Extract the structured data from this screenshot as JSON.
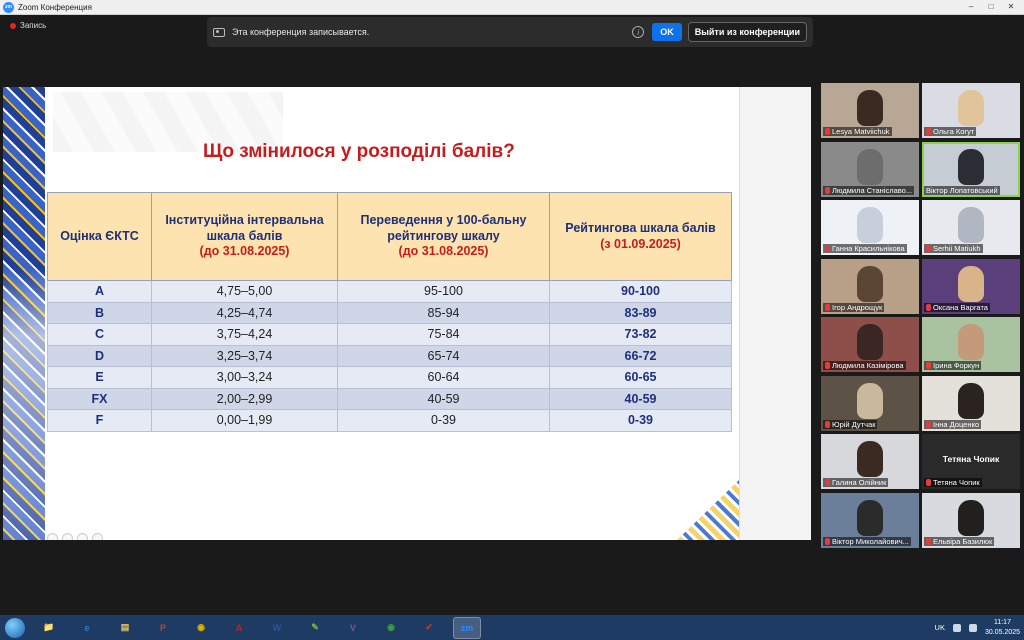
{
  "window": {
    "title": "Zoom Конференция",
    "controls": [
      "–",
      "□",
      "✕"
    ]
  },
  "recording": {
    "label": "Запись",
    "notice": "Эта конференция записывается.",
    "ok_label": "OK",
    "leave_label": "Выйти из конференции"
  },
  "slide": {
    "title": "Що змінилося у розподілі балів?",
    "headers": [
      {
        "main": "Оцінка ЄКТС",
        "note": ""
      },
      {
        "main": "Інституційна інтервальна шкала балів",
        "note": "(до 31.08.2025)"
      },
      {
        "main": "Переведення у 100-бальну рейтингову шкалу",
        "note": "(до 31.08.2025)"
      },
      {
        "main": "Рейтингова шкала балів",
        "note": "(з 01.09.2025)"
      }
    ],
    "rows": [
      [
        "A",
        "4,75–5,00",
        "95-100",
        "90-100"
      ],
      [
        "B",
        "4,25–4,74",
        "85-94",
        "83-89"
      ],
      [
        "C",
        "3,75–4,24",
        "75-84",
        "73-82"
      ],
      [
        "D",
        "3,25–3,74",
        "65-74",
        "66-72"
      ],
      [
        "E",
        "3,00–3,24",
        "60-64",
        "60-65"
      ],
      [
        "FX",
        "2,00–2,99",
        "40-59",
        "40-59"
      ],
      [
        "F",
        "0,00–1,99",
        "0-39",
        "0-39"
      ]
    ]
  },
  "participants": [
    {
      "name": "Lesya Matviichuk",
      "muted": true,
      "bg": "#b9a796",
      "face": "#3b2a22"
    },
    {
      "name": "Ольга Когут",
      "muted": true,
      "bg": "#d9dde3",
      "face": "#e1c49a"
    },
    {
      "name": "Людмила Станіславо...",
      "muted": true,
      "bg": "#8a8a8a",
      "face": "#6d6d6d"
    },
    {
      "name": "Віктор Лопатовський",
      "muted": false,
      "bg": "#c6ccd4",
      "face": "#2c2c34",
      "active": true
    },
    {
      "name": "Ганна Красильнікова",
      "muted": true,
      "bg": "#eef2f7",
      "face": "#c7cfdb"
    },
    {
      "name": "Serhii Matiukh",
      "muted": true,
      "bg": "#e7e9ee",
      "face": "#b0b7c3"
    },
    {
      "name": "Ігор Андрощук",
      "muted": true,
      "bg": "#b8a088",
      "face": "#5b4636"
    },
    {
      "name": "Оксана Варгата",
      "muted": true,
      "bg": "#5a3f7a",
      "face": "#d9b489"
    },
    {
      "name": "Людмила Казімірова",
      "muted": true,
      "bg": "#8e4f4b",
      "face": "#3a2622"
    },
    {
      "name": "Ірина Форкун",
      "muted": true,
      "bg": "#a9c3a0",
      "face": "#c49a7a"
    },
    {
      "name": "Юрій Дутчак",
      "muted": true,
      "bg": "#5c5346",
      "face": "#c9b89b"
    },
    {
      "name": "Інна Доценко",
      "muted": true,
      "bg": "#e4e0da",
      "face": "#2a2320"
    },
    {
      "name": "Галина Олійник",
      "muted": true,
      "bg": "#d6d8db",
      "face": "#3b2a22"
    },
    {
      "name": "Тетяна Чопик",
      "muted": true,
      "bg": "#2a2a2a",
      "face": "",
      "big": "Тетяна Чопик"
    },
    {
      "name": "Віктор Миколайович...",
      "muted": true,
      "bg": "#6b7f9a",
      "face": "#2b2b2b"
    },
    {
      "name": "Ельвіра Базилюк",
      "muted": true,
      "bg": "#d7dadf",
      "face": "#22201f"
    }
  ],
  "taskbar": {
    "apps": [
      {
        "name": "explorer-app",
        "label": "📁",
        "color": "#d7a634"
      },
      {
        "name": "ie-app",
        "label": "e",
        "color": "#2a7bd6"
      },
      {
        "name": "folder-app",
        "label": "▤",
        "color": "#e6c35a"
      },
      {
        "name": "powerpoint-app",
        "label": "P",
        "color": "#c2462b"
      },
      {
        "name": "chrome-app",
        "label": "◉",
        "color": "#e6b500"
      },
      {
        "name": "acrobat-app",
        "label": "A",
        "color": "#c71f1f"
      },
      {
        "name": "word-app",
        "label": "W",
        "color": "#2b579a"
      },
      {
        "name": "paint-app",
        "label": "✎",
        "color": "#7fb13a"
      },
      {
        "name": "viber-app",
        "label": "V",
        "color": "#7b519d"
      },
      {
        "name": "chrome2-app",
        "label": "◉",
        "color": "#3a9e45"
      },
      {
        "name": "tool-app",
        "label": "✔",
        "color": "#c0392b"
      },
      {
        "name": "zoom-app",
        "label": "zm",
        "color": "#2d8cff"
      }
    ],
    "lang": "UK",
    "time": "11:17",
    "date": "30.05.2025"
  }
}
